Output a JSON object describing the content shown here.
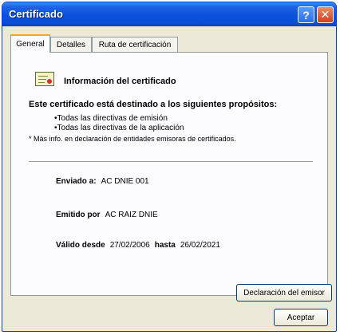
{
  "window": {
    "title": "Certificado"
  },
  "titlebar": {
    "help_glyph": "?",
    "close_glyph": "✕"
  },
  "tabs": [
    {
      "label": "General",
      "active": true
    },
    {
      "label": "Detalles",
      "active": false
    },
    {
      "label": "Ruta de certificación",
      "active": false
    }
  ],
  "general": {
    "info_title": "Información del certificado",
    "purposes_heading": "Este certificado está destinado a los siguientes propósitos:",
    "purposes": [
      "•Todas las directivas de emisión",
      "•Todas las directivas de la aplicación"
    ],
    "more_info": "* Más info. en declaración de entidades emisoras de certificados.",
    "issued_to": {
      "label": "Enviado a:",
      "value": "AC DNIE 001"
    },
    "issued_by": {
      "label": "Emitido por",
      "value": "AC RAIZ DNIE"
    },
    "validity": {
      "from_label": "Válido desde",
      "from_value": "27/02/2006",
      "to_label": "hasta",
      "to_value": "26/02/2021"
    },
    "declaration_button": "Declaración del emisor"
  },
  "footer": {
    "accept_button": "Aceptar"
  },
  "icons": [
    "certificate-icon",
    "help-icon",
    "close-icon"
  ]
}
